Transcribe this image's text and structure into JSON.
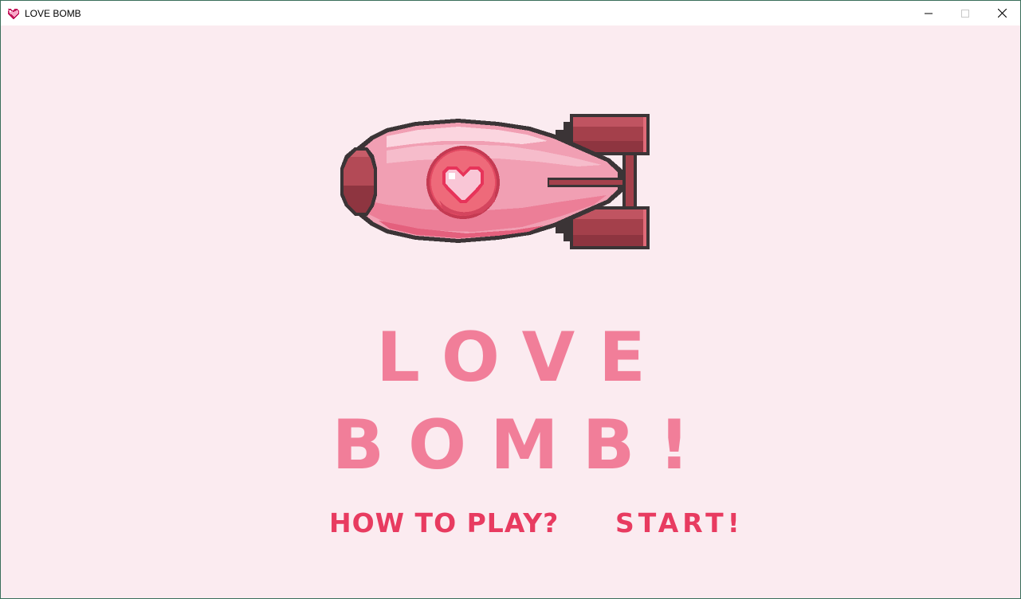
{
  "window": {
    "title": "LOVE BOMB",
    "icon": "pixel-heart-icon"
  },
  "controls": {
    "minimize_icon": "minimize-icon",
    "maximize_icon": "maximize-icon",
    "close_icon": "close-icon"
  },
  "game": {
    "title": "LOVE BOMB!",
    "background_color": "#fbebf0",
    "title_color": "#f17e99",
    "button_color": "#e83b60",
    "illustration": "love-bomb-icon",
    "buttons": {
      "how_to_play": "HOW TO PLAY?",
      "start": "START!"
    }
  }
}
